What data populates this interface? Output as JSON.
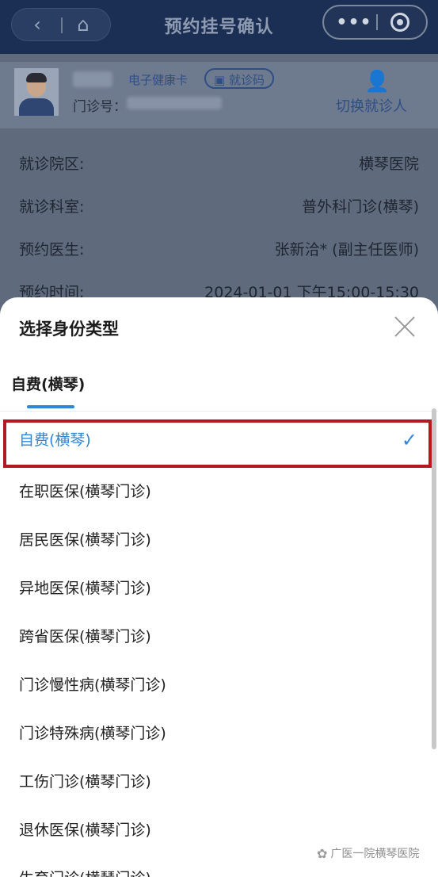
{
  "nav": {
    "back_icon": "‹",
    "home_icon": "⌂",
    "title": "预约挂号确认",
    "more_icon": "•••"
  },
  "patient": {
    "health_card_label": "电子健康卡",
    "visit_code_label": "就诊码",
    "outpatient_label": "门诊号：",
    "switch_label": "切换就诊人"
  },
  "info": {
    "campus_label": "就诊院区:",
    "campus_value": "横琴医院",
    "dept_label": "就诊科室:",
    "dept_value": "普外科门诊(横琴)",
    "doctor_label": "预约医生:",
    "doctor_value": "张新洽* (副主任医师)",
    "time_label": "预约时间:",
    "time_value": "2024-01-01 下午15:00-15:30"
  },
  "sheet": {
    "title": "选择身份类型",
    "active_tab": "自费(横琴)",
    "options": [
      "自费(横琴)",
      "在职医保(横琴门诊)",
      "居民医保(横琴门诊)",
      "异地医保(横琴门诊)",
      "跨省医保(横琴门诊)",
      "门诊慢性病(横琴门诊)",
      "门诊特殊病(横琴门诊)",
      "工伤门诊(横琴门诊)",
      "退休医保(横琴门诊)",
      "生育门诊(横琴门诊)"
    ],
    "selected_index": 0,
    "check_mark": "✓"
  },
  "watermark": {
    "text": "广医一院横琴医院"
  },
  "colors": {
    "accent": "#2f86d9",
    "highlight_border": "#b3191f",
    "nav_bg": "#1b2f55"
  }
}
